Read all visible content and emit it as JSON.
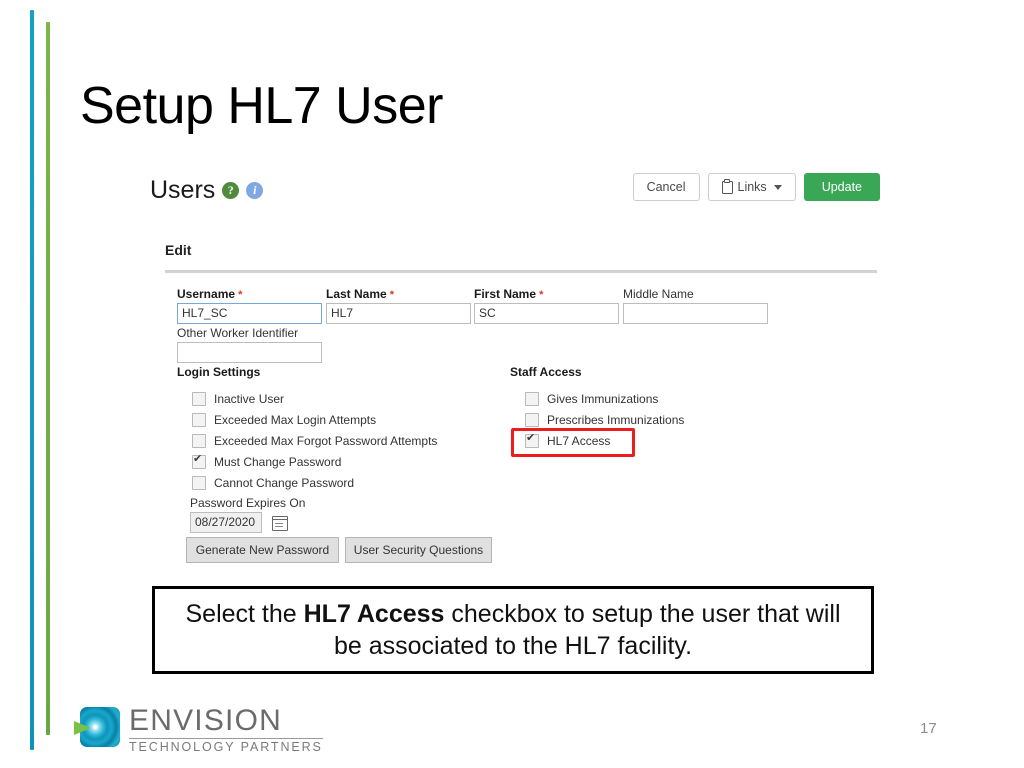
{
  "slide": {
    "title": "Setup HL7 User",
    "page_number": "17"
  },
  "app": {
    "page_heading": "Users",
    "help_icon": "help-circle-icon",
    "info_icon": "info-circle-icon",
    "toolbar": {
      "cancel_label": "Cancel",
      "links_label": "Links",
      "links_icon": "clipboard-icon",
      "links_caret": "chevron-down-icon",
      "update_label": "Update",
      "update_color": "#3aa757"
    },
    "section_title": "Edit",
    "fields": [
      {
        "label": "Username",
        "required": true,
        "value": "HL7_SC",
        "focused": true
      },
      {
        "label": "Last Name",
        "required": true,
        "value": "HL7",
        "focused": false
      },
      {
        "label": "First Name",
        "required": true,
        "value": "SC",
        "focused": false
      },
      {
        "label": "Middle Name",
        "required": false,
        "value": "",
        "focused": false
      }
    ],
    "other_worker": {
      "label": "Other Worker Identifier",
      "value": ""
    },
    "login_settings": {
      "title": "Login Settings",
      "items": [
        {
          "label": "Inactive User",
          "checked": false
        },
        {
          "label": "Exceeded Max Login Attempts",
          "checked": false
        },
        {
          "label": "Exceeded Max Forgot Password Attempts",
          "checked": false
        },
        {
          "label": "Must Change Password",
          "checked": true
        },
        {
          "label": "Cannot Change Password",
          "checked": false
        }
      ]
    },
    "staff_access": {
      "title": "Staff Access",
      "items": [
        {
          "label": "Gives Immunizations",
          "checked": false,
          "highlighted": false
        },
        {
          "label": "Prescribes Immunizations",
          "checked": false,
          "highlighted": false
        },
        {
          "label": "HL7 Access",
          "checked": true,
          "highlighted": true
        }
      ],
      "highlight_color": "#ee1d1d"
    },
    "password_expires": {
      "label": "Password Expires On",
      "value": "08/27/2020",
      "calendar_icon": "calendar-icon"
    },
    "buttons": {
      "generate_password": "Generate New Password",
      "security_questions": "User Security Questions"
    }
  },
  "caption": {
    "prefix": "Select the ",
    "bold": "HL7 Access",
    "suffix": " checkbox to setup the user that will be associated to the HL7 facility."
  },
  "footer": {
    "logo_name": "ENVISION",
    "logo_sub": "TECHNOLOGY PARTNERS"
  }
}
